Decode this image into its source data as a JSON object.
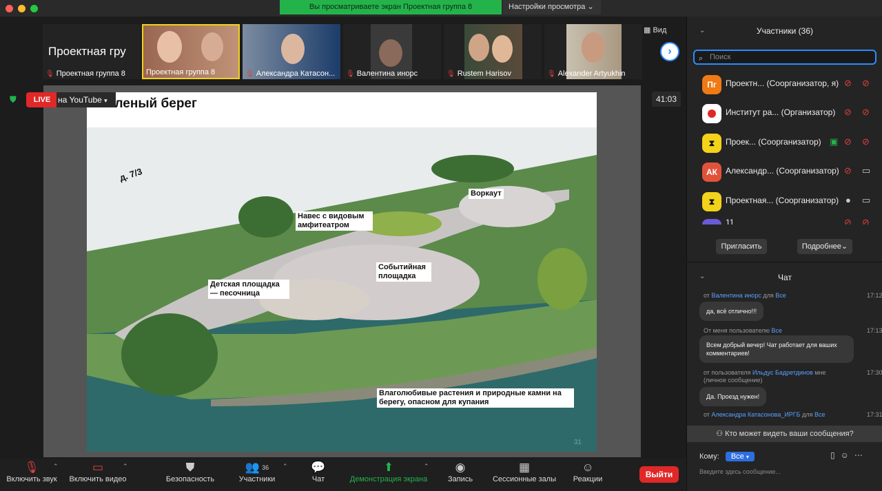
{
  "titlebar": {
    "share_banner": "Вы просматриваете экран Проектная группа 8",
    "view_settings": "Настройки просмотра"
  },
  "thumbnails": [
    {
      "name": "Проектная группа 8",
      "big_text": "Проектная гру"
    },
    {
      "name": "Проектная группа 8"
    },
    {
      "name": "Александра Катасон..."
    },
    {
      "name": "Валентина инорс"
    },
    {
      "name": "Rustem Harisov"
    },
    {
      "name": "Alexander Artyukhin"
    }
  ],
  "view_label": "Вид",
  "live": {
    "badge": "LIVE",
    "platform": "на YouTube"
  },
  "timer": "41:03",
  "slide": {
    "title": "Зеленый берег",
    "page": "31",
    "labels": {
      "building": "д. 7/3",
      "workout": "Воркаут",
      "canopy": "Навес с видовым амфитеатром",
      "event": "Событийная площадка",
      "kids": "Детская площадка — песочница",
      "plants": "Влаголюбивые растения  и природные камни на берегу, опасном для купания"
    }
  },
  "participants": {
    "header": "Участники (36)",
    "search_placeholder": "Поиск",
    "list": [
      {
        "initials": "Пг",
        "name": "Проектн...  (Соорганизатор, я)",
        "color": "#f07a14"
      },
      {
        "initials": "",
        "name": "Институт ра...  (Организатор)",
        "color": "#ffffff"
      },
      {
        "initials": "",
        "name": "Проек...  (Соорганизатор)",
        "color": "#f2d21a"
      },
      {
        "initials": "АК",
        "name": "Александр...  (Соорганизатор)",
        "color": "#e0533a"
      },
      {
        "initials": "",
        "name": "Проектная...  (Соорганизатор)",
        "color": "#f2d21a"
      },
      {
        "initials": "",
        "name": "11",
        "color": "#6a5ad8"
      }
    ],
    "invite": "Пригласить",
    "more": "Подробнее"
  },
  "chat": {
    "header": "Чат",
    "messages": [
      {
        "prefix": "от",
        "from": "Валентина инорс",
        "mid": "для",
        "to": "Все",
        "time": "17:12",
        "text": "да, всё отлично!!!"
      },
      {
        "prefix": "От меня пользователю",
        "from": "",
        "mid": "",
        "to": "Все",
        "time": "17:13",
        "text": "Всем добрый вечер! Чат работает для ваших комментариев!"
      },
      {
        "prefix": "от пользователя",
        "from": "Ильдус Бадретдинов",
        "mid": "мне",
        "to": "",
        "time": "17:30",
        "extra": "(личное сообщение)",
        "text": "Да. Проезд нужен!"
      },
      {
        "prefix": "от",
        "from": "Александра Катасонова_ИРГБ",
        "mid": "для",
        "to": "Все",
        "time": "17:31",
        "text": ""
      }
    ],
    "who_can_see": "Кто может видеть ваши сообщения?",
    "to_label": "Кому:",
    "to_value": "Все",
    "input_placeholder": "Введите здесь сообщение..."
  },
  "toolbar": {
    "mute": "Включить звук",
    "video": "Включить видео",
    "security": "Безопасность",
    "participants": "Участники",
    "participants_count": "36",
    "chat": "Чат",
    "share": "Демонстрация экрана",
    "record": "Запись",
    "breakout": "Сессионные залы",
    "reactions": "Реакции",
    "leave": "Выйти"
  },
  "colors": {
    "accent": "#2d8cff",
    "share_green": "#24b34b",
    "danger": "#e02828"
  }
}
